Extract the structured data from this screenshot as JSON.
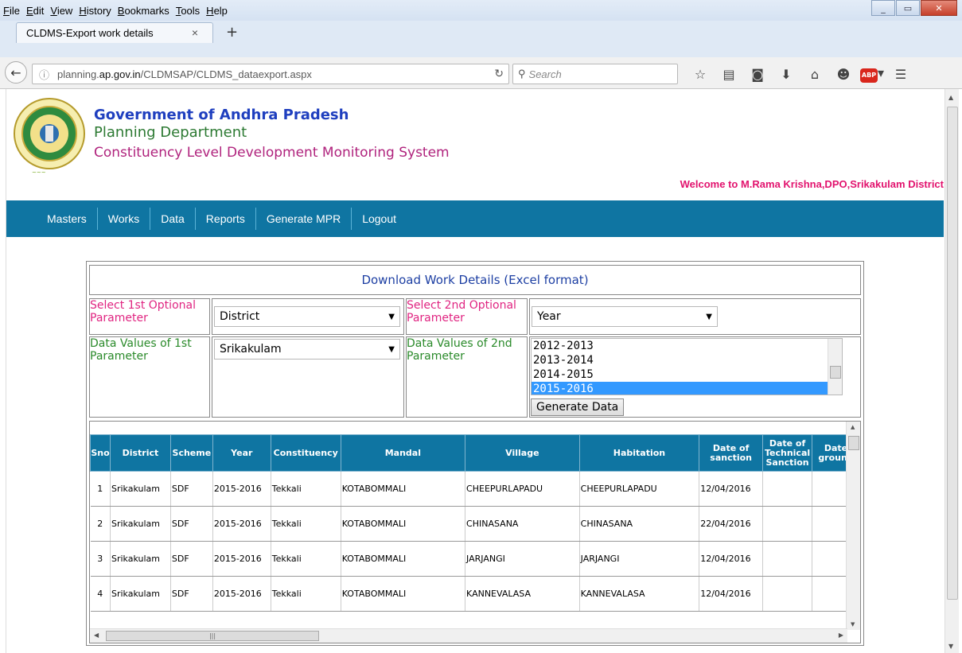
{
  "browser": {
    "menu": [
      "File",
      "Edit",
      "View",
      "History",
      "Bookmarks",
      "Tools",
      "Help"
    ],
    "tab_title": "CLDMS-Export work details",
    "url_prefix": "planning.",
    "url_domain": "ap.gov.in",
    "url_path": "/CLDMSAP/CLDMS_dataexport.aspx",
    "search_placeholder": "Search"
  },
  "header": {
    "title": "Government of Andhra Pradesh",
    "department": "Planning Department",
    "system": "Constituency Level Development Monitoring System",
    "welcome": "Welcome to M.Rama Krishna,DPO,Srikakulam District"
  },
  "nav": [
    "Masters",
    "Works",
    "Data",
    "Reports",
    "Generate MPR",
    "Logout"
  ],
  "form": {
    "title": "Download Work Details (Excel format)",
    "param1_label": "Select 1st Optional Parameter",
    "param1_value": "District",
    "param2_label": "Select 2nd Optional Parameter",
    "param2_value": "Year",
    "values1_label": "Data Values of 1st Parameter",
    "values1_value": "Srikakulam",
    "values2_label": "Data Values of 2nd Parameter",
    "years": [
      "2012-2013",
      "2013-2014",
      "2014-2015",
      "2015-2016"
    ],
    "selected_year": "2015-2016",
    "generate_label": "Generate Data"
  },
  "table": {
    "columns": [
      "Sno",
      "District",
      "Scheme",
      "Year",
      "Constituency",
      "Mandal",
      "Village",
      "Habitation",
      "Date of sanction",
      "Date of Technical Sanction",
      "Date ground"
    ],
    "rows": [
      [
        "1",
        "Srikakulam",
        "SDF",
        "2015-2016",
        "Tekkali",
        "KOTABOMMALI",
        "CHEEPURLAPADU",
        "CHEEPURLAPADU",
        "12/04/2016",
        "",
        ""
      ],
      [
        "2",
        "Srikakulam",
        "SDF",
        "2015-2016",
        "Tekkali",
        "KOTABOMMALI",
        "CHINASANA",
        "CHINASANA",
        "22/04/2016",
        "",
        ""
      ],
      [
        "3",
        "Srikakulam",
        "SDF",
        "2015-2016",
        "Tekkali",
        "KOTABOMMALI",
        "JARJANGI",
        "JARJANGI",
        "12/04/2016",
        "",
        ""
      ],
      [
        "4",
        "Srikakulam",
        "SDF",
        "2015-2016",
        "Tekkali",
        "KOTABOMMALI",
        "KANNEVALASA",
        "KANNEVALASA",
        "12/04/2016",
        "",
        ""
      ]
    ]
  },
  "colors": {
    "nav_bg": "#0f75a2",
    "title_blue": "#1f3fbf",
    "dept_green": "#2d7a33",
    "system_magenta": "#b0237d",
    "welcome_pink": "#e2136e",
    "selected_blue": "#3399ff"
  }
}
